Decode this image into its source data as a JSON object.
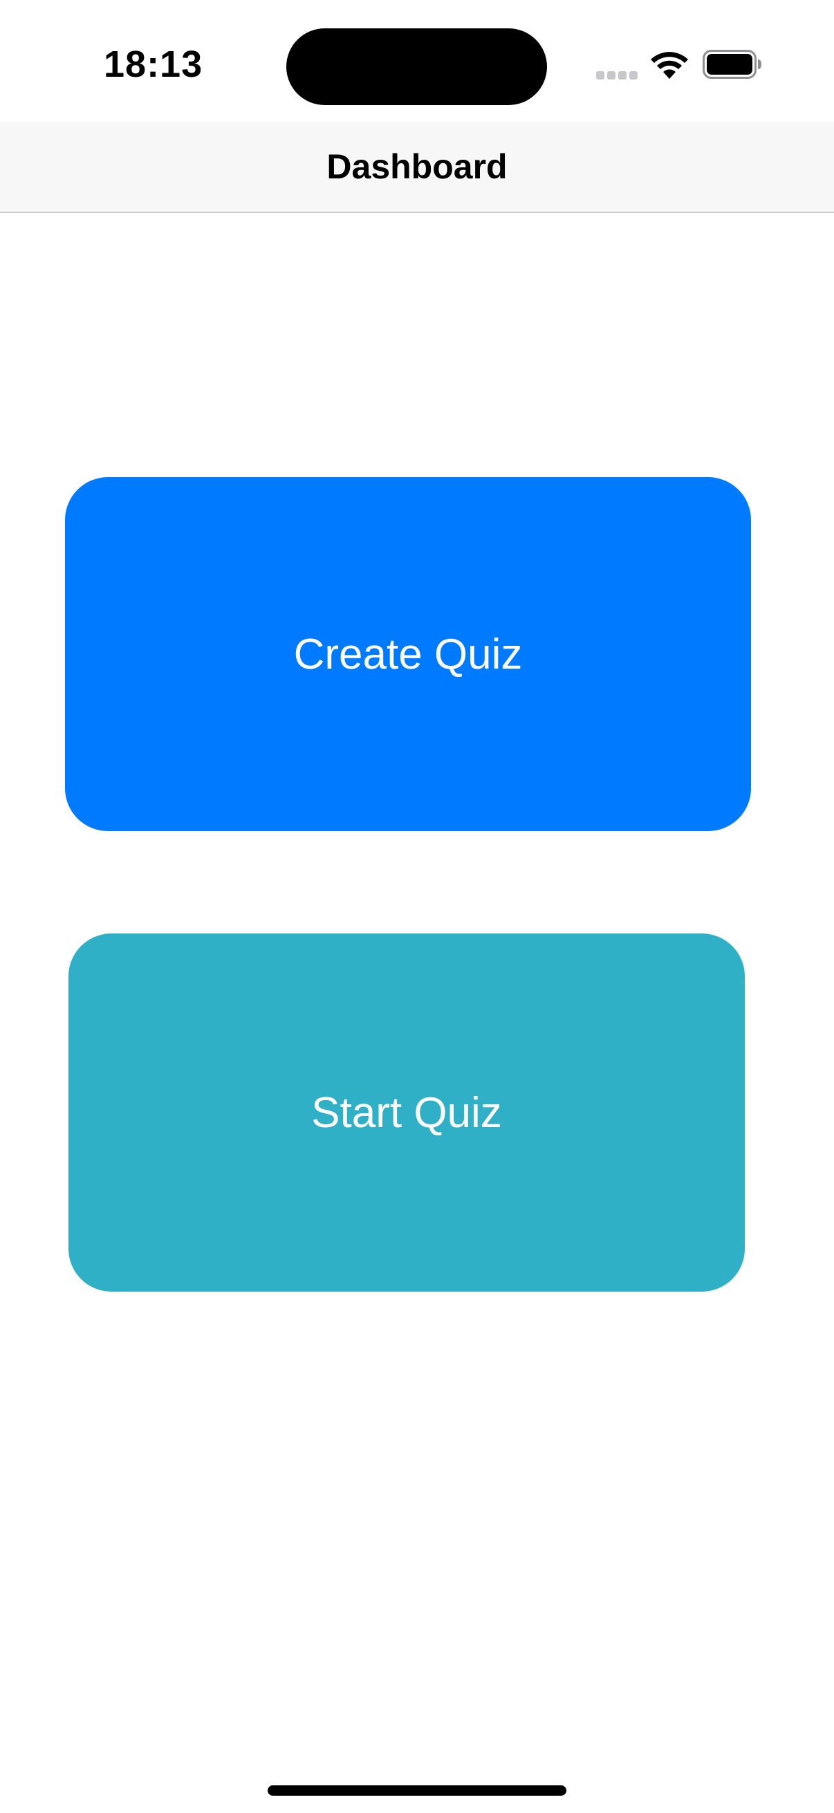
{
  "status_bar": {
    "time": "18:13",
    "icons": {
      "signal": "cellular-signal-icon",
      "wifi": "wifi-icon",
      "battery": "battery-icon"
    }
  },
  "nav_bar": {
    "title": "Dashboard"
  },
  "buttons": {
    "create_quiz": {
      "label": "Create Quiz",
      "color": "#007AFF"
    },
    "start_quiz": {
      "label": "Start Quiz",
      "color": "#30B0C7"
    }
  },
  "colors": {
    "nav_background": "#F7F7F7",
    "background": "#FFFFFF"
  }
}
